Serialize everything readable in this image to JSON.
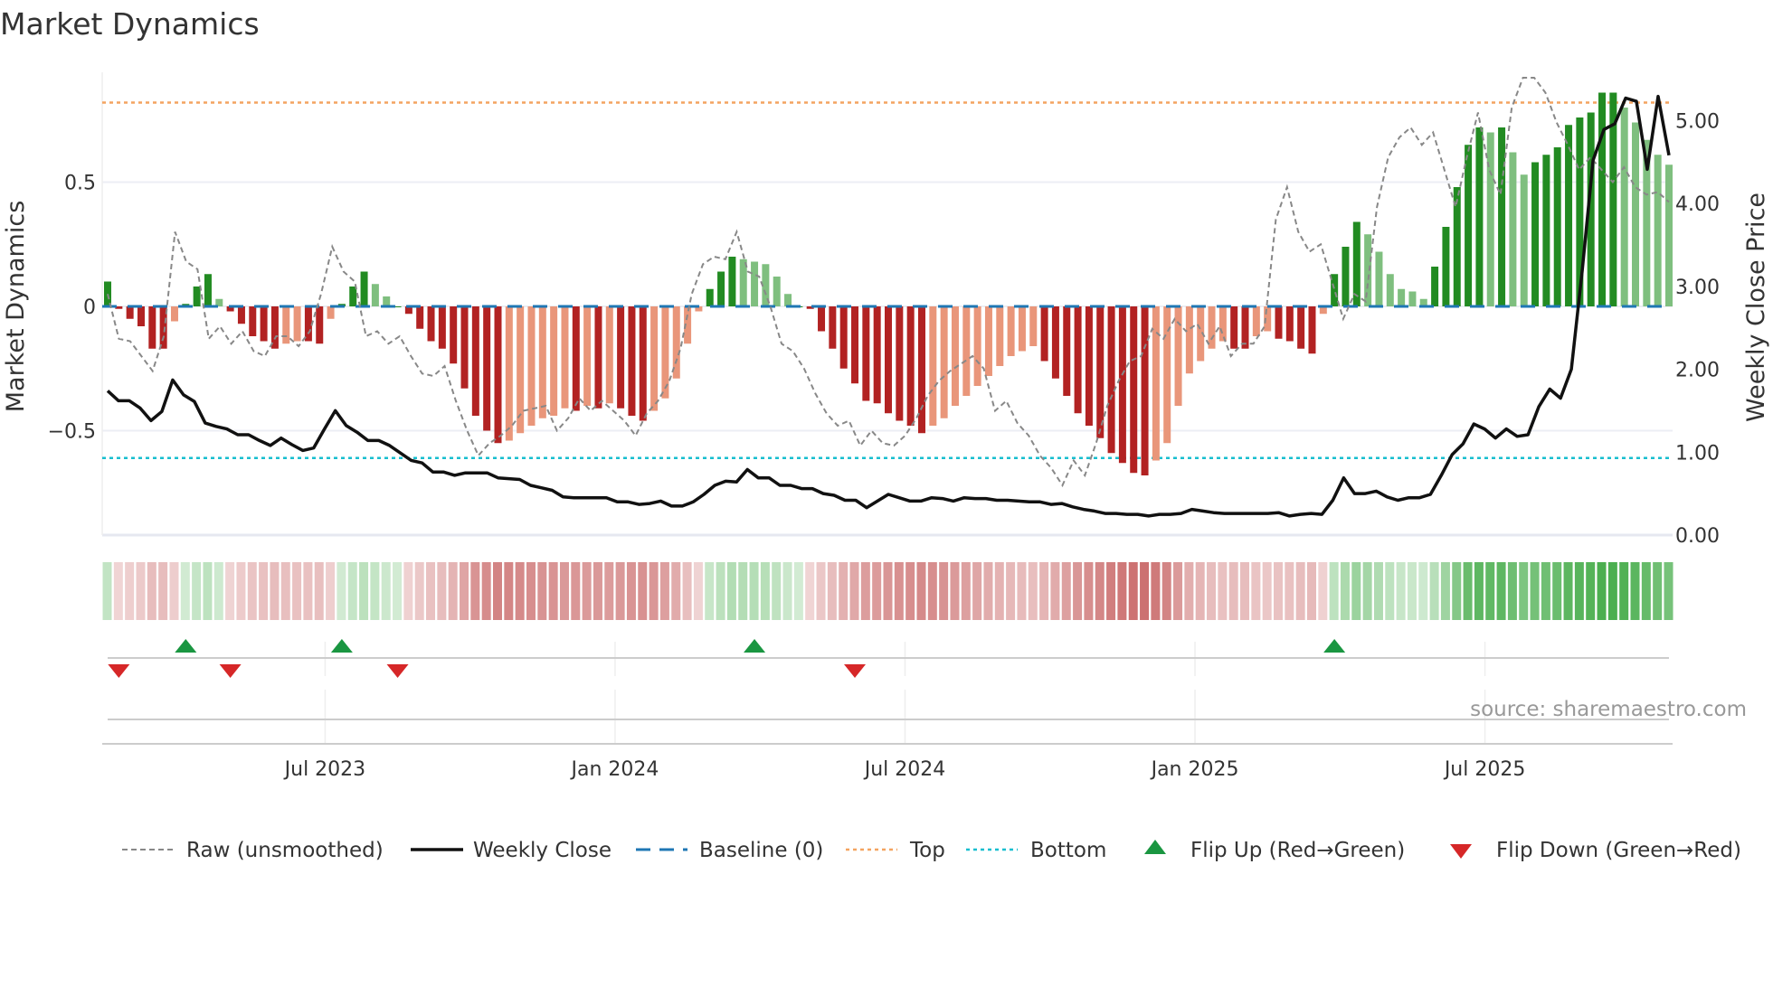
{
  "chart_data": {
    "type": "bar",
    "title": "Market Dynamics",
    "ylabel": "Market Dynamics",
    "y2label": "Weekly Close Price",
    "ylim": [
      -0.92,
      0.94
    ],
    "y2lim": [
      0,
      5.6
    ],
    "yticks": [
      {
        "v": 0.5,
        "label": "0.5"
      },
      {
        "v": 0,
        "label": "0"
      },
      {
        "v": -0.5,
        "label": "−0.5"
      }
    ],
    "y2ticks": [
      {
        "v": 5,
        "label": "5.00"
      },
      {
        "v": 4,
        "label": "4.00"
      },
      {
        "v": 3,
        "label": "3.00"
      },
      {
        "v": 2,
        "label": "2.00"
      },
      {
        "v": 1,
        "label": "1.00"
      },
      {
        "v": 0,
        "label": "0.00"
      }
    ],
    "xticks": [
      {
        "week": 19.5,
        "label": "Jul 2023"
      },
      {
        "week": 45.5,
        "label": "Jan 2024"
      },
      {
        "week": 71.5,
        "label": "Jul 2024"
      },
      {
        "week": 97.5,
        "label": "Jan 2025"
      },
      {
        "week": 123.5,
        "label": "Jul 2025"
      }
    ],
    "top_level": 0.82,
    "bottom_level": -0.61,
    "baseline": 0,
    "colors": {
      "up_strong": "#228b22",
      "up_weak": "#7fbf7f",
      "down_strong": "#b22222",
      "down_weak": "#e9967a",
      "top": "#f4a460",
      "bottom": "#17becf",
      "baseline": "#1f77b4",
      "raw": "#888888",
      "close": "#111111",
      "flip_up": "#1a9641",
      "flip_down": "#d62728"
    },
    "dynamics": [
      0.1,
      -0.01,
      -0.05,
      -0.08,
      -0.17,
      -0.17,
      -0.06,
      0.01,
      0.08,
      0.13,
      0.03,
      -0.02,
      -0.07,
      -0.12,
      -0.14,
      -0.17,
      -0.15,
      -0.14,
      -0.14,
      -0.15,
      -0.05,
      0.01,
      0.08,
      0.14,
      0.09,
      0.04,
      0.0,
      -0.03,
      -0.09,
      -0.14,
      -0.17,
      -0.23,
      -0.33,
      -0.44,
      -0.5,
      -0.55,
      -0.54,
      -0.51,
      -0.48,
      -0.45,
      -0.44,
      -0.41,
      -0.42,
      -0.4,
      -0.41,
      -0.39,
      -0.41,
      -0.44,
      -0.46,
      -0.42,
      -0.37,
      -0.29,
      -0.15,
      -0.02,
      0.07,
      0.14,
      0.2,
      0.19,
      0.18,
      0.17,
      0.12,
      0.05,
      0.0,
      -0.01,
      -0.1,
      -0.17,
      -0.25,
      -0.31,
      -0.38,
      -0.39,
      -0.43,
      -0.46,
      -0.48,
      -0.51,
      -0.48,
      -0.45,
      -0.4,
      -0.36,
      -0.32,
      -0.28,
      -0.24,
      -0.2,
      -0.18,
      -0.16,
      -0.22,
      -0.29,
      -0.36,
      -0.43,
      -0.48,
      -0.53,
      -0.59,
      -0.63,
      -0.67,
      -0.68,
      -0.62,
      -0.55,
      -0.4,
      -0.27,
      -0.22,
      -0.17,
      -0.14,
      -0.17,
      -0.17,
      -0.12,
      -0.1,
      -0.13,
      -0.14,
      -0.17,
      -0.19,
      -0.03,
      0.13,
      0.24,
      0.34,
      0.29,
      0.22,
      0.13,
      0.07,
      0.06,
      0.03,
      0.16,
      0.32,
      0.48,
      0.65,
      0.72,
      0.7,
      0.72,
      0.62,
      0.53,
      0.58,
      0.61,
      0.64,
      0.73,
      0.76,
      0.78,
      0.86,
      0.86,
      0.8,
      0.74,
      0.67,
      0.61,
      0.57
    ],
    "raw": [
      0.05,
      -0.13,
      -0.14,
      -0.2,
      -0.26,
      -0.12,
      0.3,
      0.18,
      0.15,
      -0.13,
      -0.08,
      -0.15,
      -0.1,
      -0.18,
      -0.2,
      -0.12,
      -0.12,
      -0.16,
      -0.1,
      0.05,
      0.24,
      0.14,
      0.1,
      -0.12,
      -0.1,
      -0.15,
      -0.12,
      -0.2,
      -0.27,
      -0.28,
      -0.24,
      -0.38,
      -0.5,
      -0.6,
      -0.55,
      -0.52,
      -0.48,
      -0.42,
      -0.41,
      -0.4,
      -0.5,
      -0.45,
      -0.37,
      -0.42,
      -0.38,
      -0.42,
      -0.46,
      -0.52,
      -0.43,
      -0.38,
      -0.3,
      -0.17,
      0.05,
      0.17,
      0.2,
      0.19,
      0.3,
      0.14,
      0.12,
      0.0,
      -0.15,
      -0.18,
      -0.25,
      -0.35,
      -0.43,
      -0.48,
      -0.46,
      -0.56,
      -0.5,
      -0.55,
      -0.56,
      -0.52,
      -0.45,
      -0.36,
      -0.3,
      -0.26,
      -0.23,
      -0.2,
      -0.25,
      -0.42,
      -0.38,
      -0.47,
      -0.52,
      -0.6,
      -0.65,
      -0.72,
      -0.62,
      -0.68,
      -0.55,
      -0.4,
      -0.3,
      -0.22,
      -0.2,
      -0.09,
      -0.13,
      -0.05,
      -0.1,
      -0.07,
      -0.15,
      -0.08,
      -0.2,
      -0.15,
      -0.15,
      -0.08,
      0.35,
      0.48,
      0.3,
      0.22,
      0.25,
      0.1,
      -0.05,
      0.05,
      0.02,
      0.4,
      0.6,
      0.68,
      0.72,
      0.65,
      0.7,
      0.55,
      0.4,
      0.6,
      0.78,
      0.55,
      0.45,
      0.8,
      0.92,
      0.92,
      0.86,
      0.74,
      0.65,
      0.55,
      0.6,
      0.55,
      0.5,
      0.56,
      0.48,
      0.45,
      0.46,
      0.42
    ],
    "weekly_close": [
      1.74,
      1.62,
      1.62,
      1.53,
      1.38,
      1.49,
      1.87,
      1.69,
      1.61,
      1.35,
      1.31,
      1.28,
      1.21,
      1.21,
      1.14,
      1.08,
      1.17,
      1.09,
      1.02,
      1.05,
      1.28,
      1.5,
      1.32,
      1.24,
      1.14,
      1.14,
      1.08,
      0.99,
      0.9,
      0.87,
      0.76,
      0.76,
      0.72,
      0.75,
      0.75,
      0.75,
      0.69,
      0.68,
      0.67,
      0.6,
      0.57,
      0.54,
      0.46,
      0.45,
      0.45,
      0.45,
      0.45,
      0.4,
      0.4,
      0.37,
      0.38,
      0.41,
      0.35,
      0.35,
      0.4,
      0.49,
      0.6,
      0.65,
      0.64,
      0.79,
      0.69,
      0.69,
      0.6,
      0.6,
      0.56,
      0.56,
      0.5,
      0.48,
      0.42,
      0.42,
      0.33,
      0.41,
      0.49,
      0.45,
      0.41,
      0.41,
      0.45,
      0.44,
      0.41,
      0.45,
      0.44,
      0.44,
      0.42,
      0.42,
      0.41,
      0.4,
      0.4,
      0.37,
      0.38,
      0.34,
      0.31,
      0.29,
      0.26,
      0.26,
      0.25,
      0.25,
      0.23,
      0.25,
      0.25,
      0.26,
      0.31,
      0.29,
      0.27,
      0.26,
      0.26,
      0.26,
      0.26,
      0.26,
      0.27,
      0.23,
      0.25,
      0.26,
      0.25,
      0.42,
      0.69,
      0.5,
      0.5,
      0.53,
      0.46,
      0.42,
      0.45,
      0.45,
      0.49,
      0.72,
      0.97,
      1.1,
      1.34,
      1.28,
      1.17,
      1.28,
      1.19,
      1.21,
      1.55,
      1.76,
      1.65,
      2.0,
      3.19,
      4.52,
      4.89,
      4.96,
      5.27,
      5.23,
      4.41,
      5.29,
      4.58
    ],
    "flips_up_weeks": [
      7,
      21,
      58,
      110
    ],
    "flips_down_weeks": [
      1,
      11,
      26,
      67
    ],
    "legend": {
      "raw": "Raw (unsmoothed)",
      "close": "Weekly Close",
      "baseline": "Baseline (0)",
      "top": "Top",
      "bottom": "Bottom",
      "flip_up": "Flip Up (Red→Green)",
      "flip_down": "Flip Down (Green→Red)"
    },
    "source": "source: sharemaestro.com"
  }
}
